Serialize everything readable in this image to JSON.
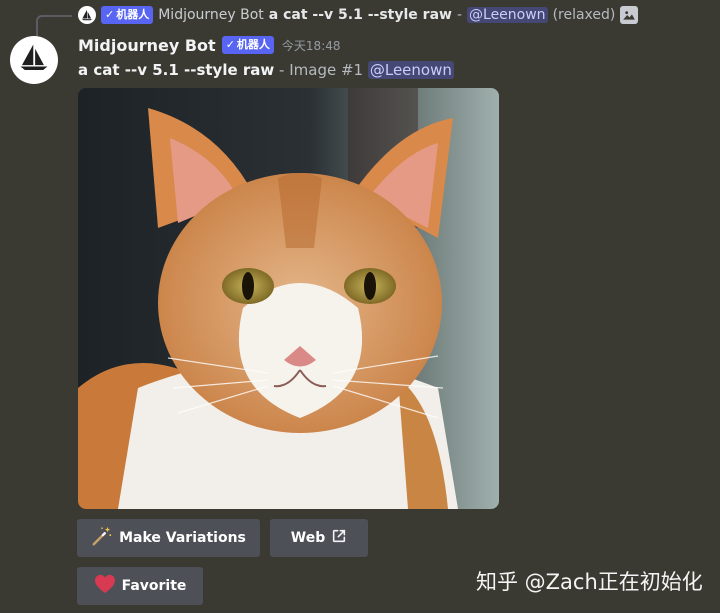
{
  "reply": {
    "badge_label": "机器人",
    "author": "Midjourney Bot",
    "prompt": "a cat --v 5.1 --style raw",
    "separator": "-",
    "mention": "@Leenown",
    "mode": "(relaxed)"
  },
  "message": {
    "username": "Midjourney Bot",
    "badge_label": "机器人",
    "timestamp": "今天18:48",
    "prompt": "a cat --v 5.1 --style raw",
    "image_label": "- Image #1",
    "mention": "@Leenown"
  },
  "buttons": {
    "variations": "Make Variations",
    "web": "Web",
    "favorite": "Favorite"
  },
  "icons": {
    "variations": "magic-wand-icon",
    "web": "external-link-icon",
    "favorite": "heart-icon",
    "avatar": "sailboat-logo-icon",
    "attachment": "image-icon"
  },
  "colors": {
    "background": "#3b3a32",
    "badge": "#5865f2",
    "button": "#4e5058",
    "heart": "#d83a52"
  },
  "watermark": "知乎 @Zach正在初始化"
}
